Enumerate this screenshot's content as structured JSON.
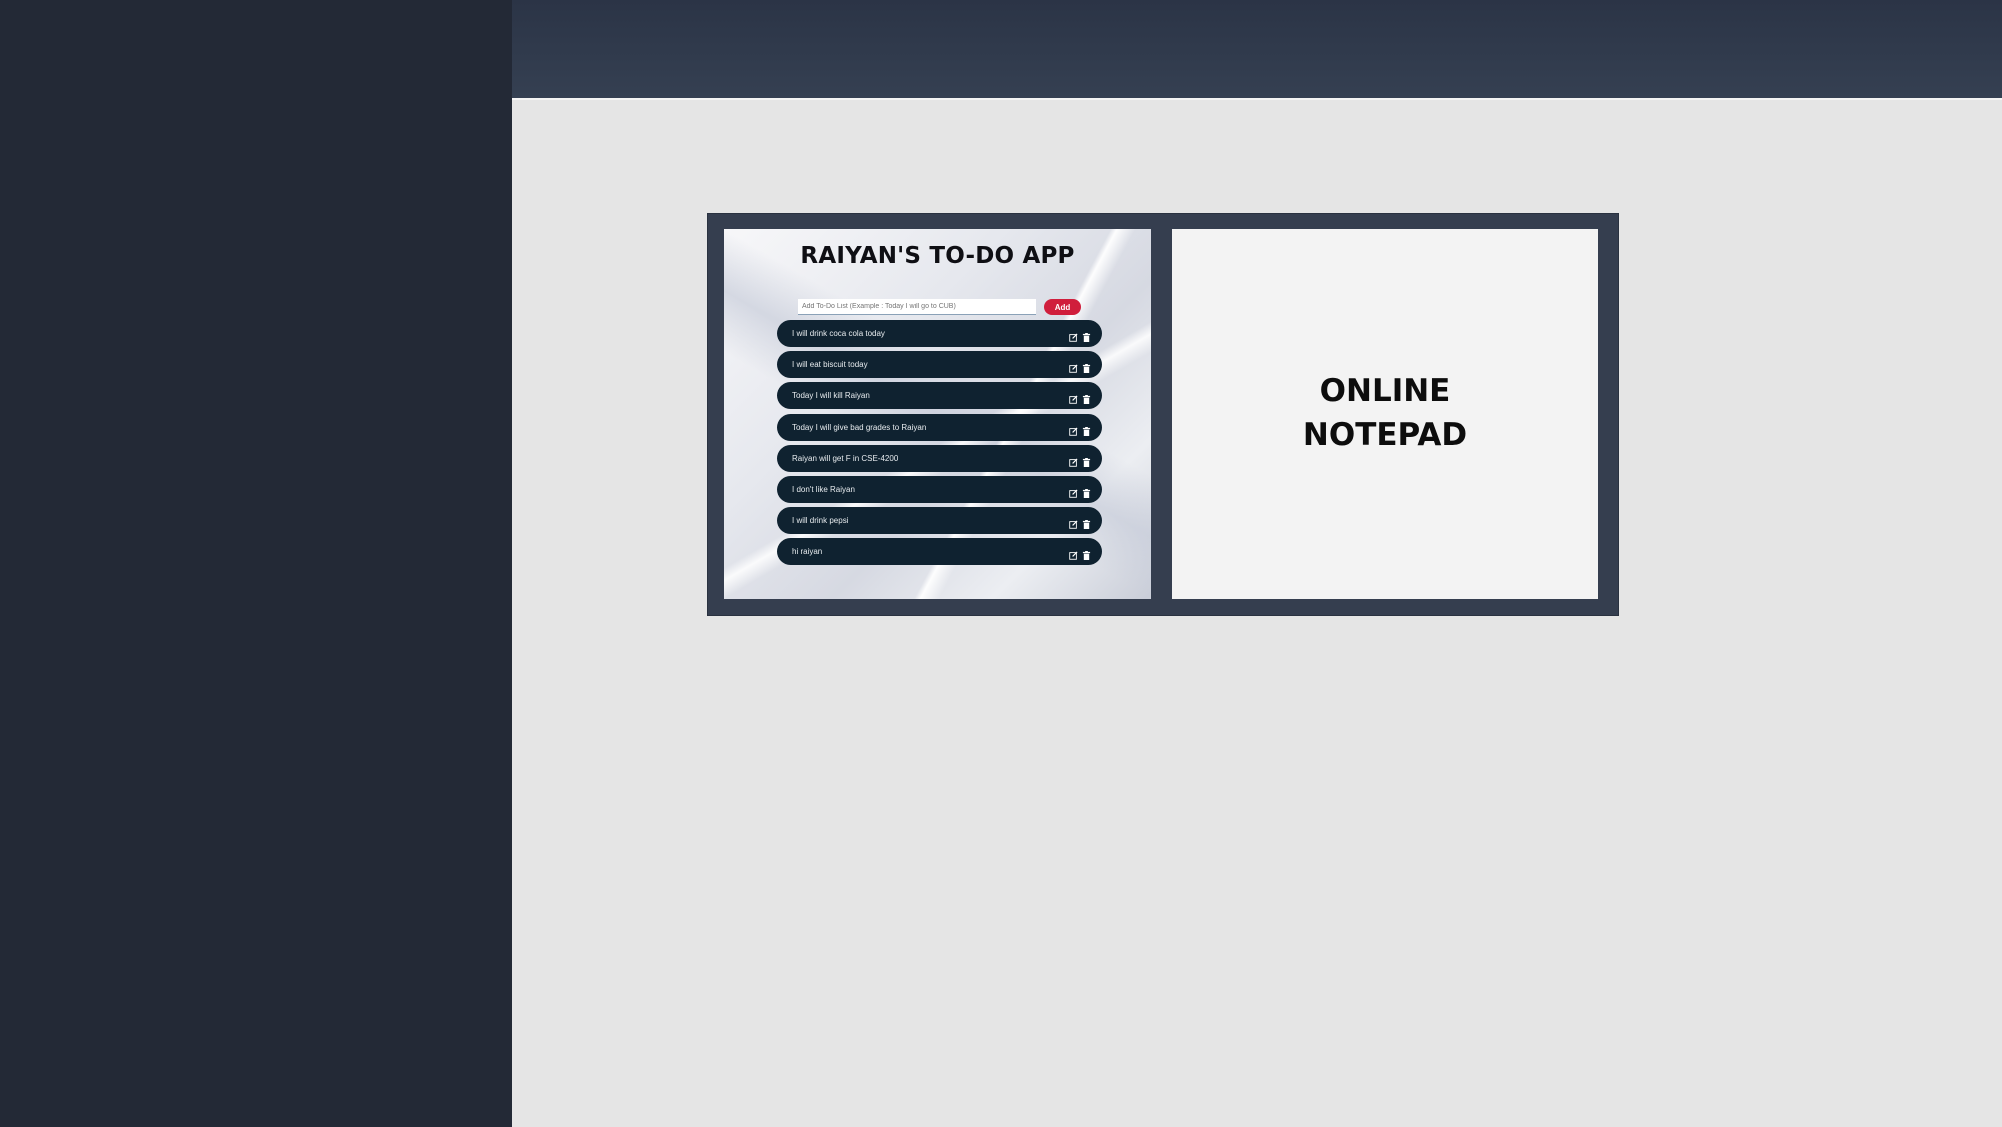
{
  "todo_app": {
    "title": "RAIYAN'S TO-DO APP",
    "input_placeholder": "Add To-Do List (Example : Today I will go to CUB)",
    "add_label": "Add",
    "items": [
      {
        "text": "I will drink coca cola today"
      },
      {
        "text": "I will eat biscuit today"
      },
      {
        "text": "Today I will kill Raiyan"
      },
      {
        "text": "Today I will give bad grades to Raiyan"
      },
      {
        "text": "Raiyan will get F in CSE-4200"
      },
      {
        "text": "I don't like Raiyan"
      },
      {
        "text": "I will drink pepsi"
      },
      {
        "text": "hi raiyan"
      }
    ],
    "item_icons": [
      "edit-icon",
      "trash-icon"
    ]
  },
  "notepad": {
    "title": "ONLINE\nNOTEPAD"
  },
  "colors": {
    "sidebar": "#232936",
    "topbar": "#354052",
    "frame": "#353e4f",
    "todo_item": "#0f2230",
    "add_button": "#d01e3c"
  }
}
